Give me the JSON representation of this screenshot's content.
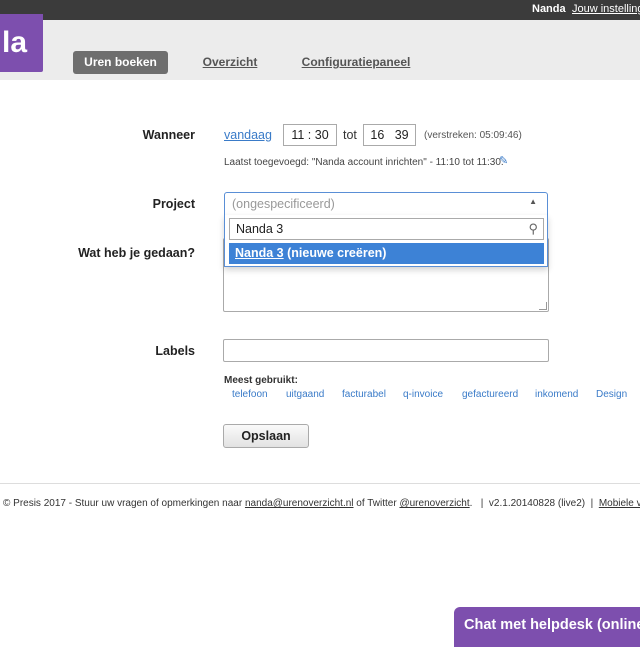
{
  "topbar": {
    "user": "Nanda",
    "settings": "Jouw instellinge"
  },
  "logo": {
    "text": "la"
  },
  "nav": {
    "tabs": [
      "Uren boeken",
      "Overzicht",
      "Configuratiepaneel"
    ]
  },
  "form": {
    "when_label": "Wanneer",
    "date_link": "vandaag",
    "start_time": "11 : 30",
    "tot": "tot",
    "end_time": "16   39",
    "elapsed": "(verstreken: 05:09:46)",
    "last_added": "Laatst toegevoegd: \"Nanda account inrichten\" - 11:10 tot 11:30.",
    "project_label": "Project",
    "project_placeholder": "(ongespecificeerd)",
    "project_search_value": "Nanda 3",
    "project_option_name": "Nanda 3",
    "project_option_suffix": " (nieuwe creëren)",
    "activity_label": "Wat heb je gedaan?",
    "labels_label": "Labels",
    "most_used_label": "Meest gebruikt:",
    "tags": [
      "telefoon",
      "uitgaand",
      "facturabel",
      "q-invoice",
      "gefactureerd",
      "inkomend",
      "Design"
    ],
    "save_label": "Opslaan"
  },
  "footer": {
    "copyright": "© Presis 2017 - Stuur uw vragen of opmerkingen naar ",
    "email": "nanda@urenoverzicht.nl",
    "mid": " of Twitter ",
    "twitter": "@urenoverzicht",
    "version": ".   |  v2.1.20140828 (live2)  |  ",
    "mobile": "Mobiele versie",
    "tail": "  |"
  },
  "chat": {
    "label": "Chat met helpdesk (online)"
  },
  "colors": {
    "brand": "#7d4fae",
    "link": "#3a7bc8",
    "selected": "#3d82d6",
    "topbar": "#3b3b3b"
  },
  "icons": [
    "pencil-icon",
    "search-icon",
    "dropdown-arrow-icon"
  ]
}
